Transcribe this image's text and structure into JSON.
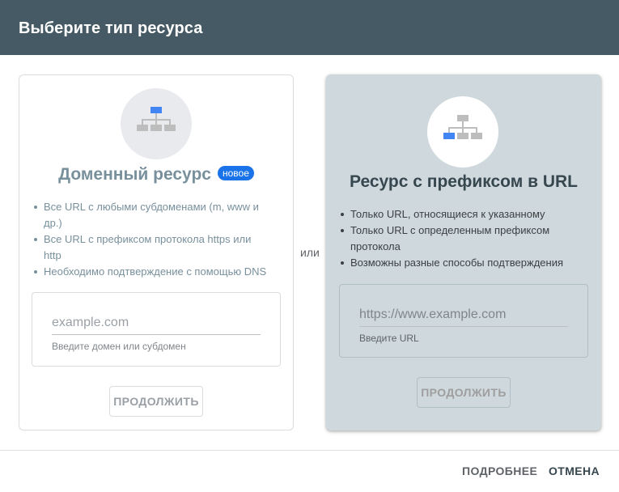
{
  "header": {
    "title": "Выберите тип ресурса"
  },
  "domain_card": {
    "title": "Доменный ресурс",
    "badge": "новое",
    "features": [
      "Все URL с любыми субдоменами (m, www и др.)",
      "Все URL с префиксом протокола https или http",
      "Необходимо подтверждение с помощью DNS"
    ],
    "input_placeholder": "example.com",
    "input_value": "",
    "input_hint": "Введите домен или субдомен",
    "continue_label": "ПРОДОЛЖИТЬ",
    "icon": "sitemap-icon"
  },
  "separator": {
    "label": "или"
  },
  "prefix_card": {
    "title": "Ресурс с префиксом в URL",
    "features": [
      "Только URL, относящиеся к указанному",
      "Только URL с определенным префиксом протокола",
      "Возможны разные способы подтверждения"
    ],
    "input_placeholder": "https://www.example.com",
    "input_value": "",
    "input_hint": "Введите URL",
    "continue_label": "ПРОДОЛЖИТЬ",
    "icon": "sitemap-icon"
  },
  "footer": {
    "more_label": "ПОДРОБНЕЕ",
    "cancel_label": "ОТМЕНА"
  },
  "colors": {
    "header_bg": "#455a64",
    "selected_card_bg": "#cfd8dc",
    "badge_bg": "#1a73e8",
    "icon_highlight": "#4285f4",
    "icon_node": "#bdbdbd"
  }
}
